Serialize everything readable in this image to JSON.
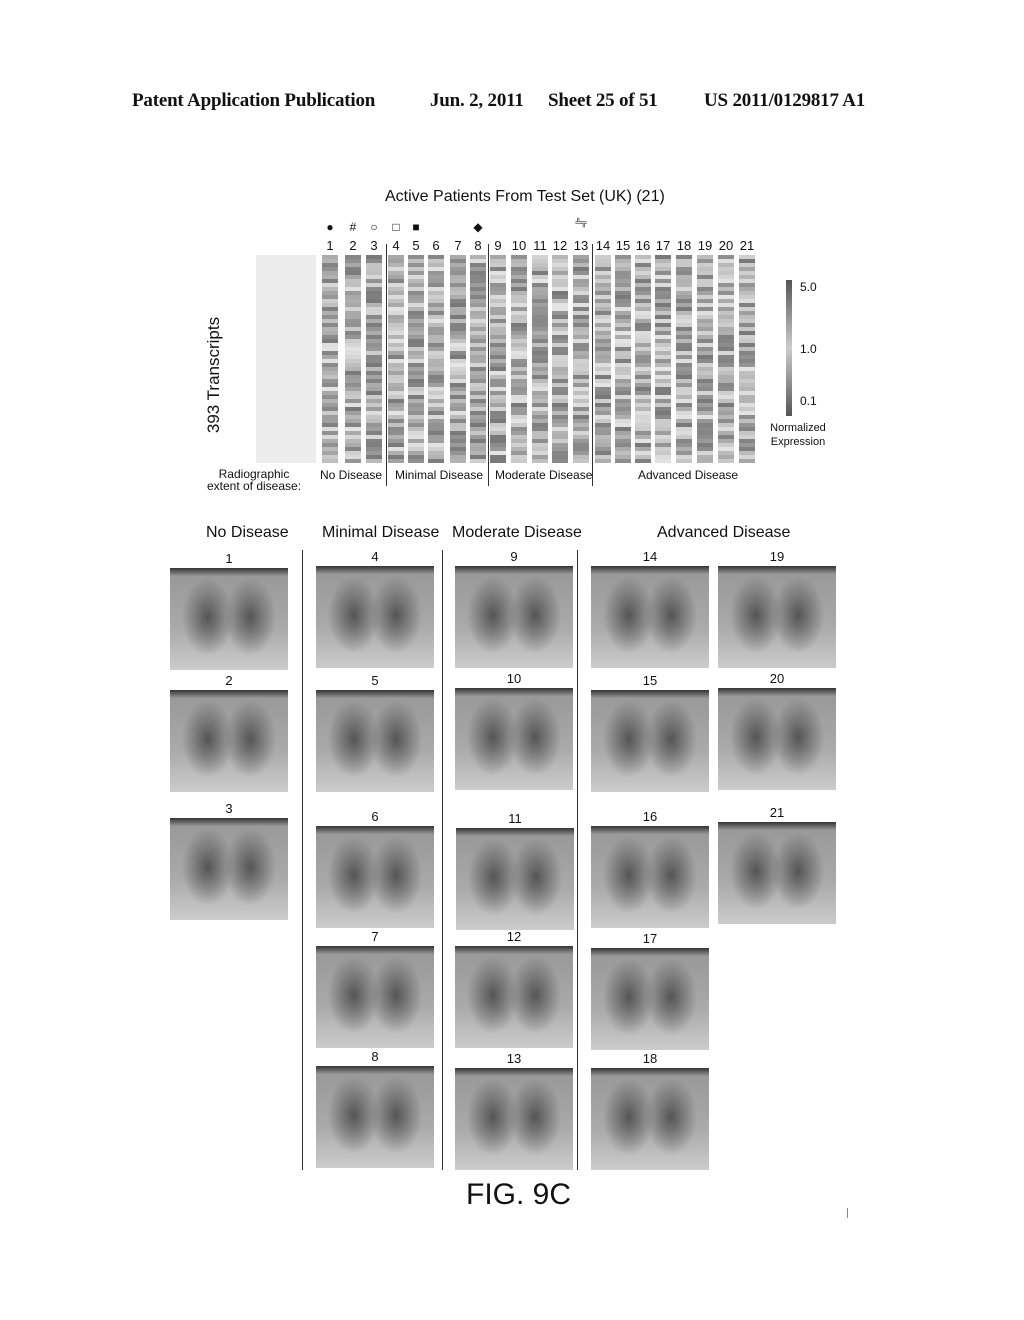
{
  "header": {
    "publication": "Patent Application Publication",
    "date": "Jun. 2, 2011",
    "sheet": "Sheet 25 of 51",
    "number": "US 2011/0129817 A1"
  },
  "heatmap": {
    "title": "Active Patients From Test Set (UK) (21)",
    "ylabel": "393 Transcripts",
    "columns": [
      "1",
      "2",
      "3",
      "4",
      "5",
      "6",
      "7",
      "8",
      "9",
      "10",
      "11",
      "12",
      "13",
      "14",
      "15",
      "16",
      "17",
      "18",
      "19",
      "20",
      "21"
    ],
    "markers": [
      {
        "col": "1",
        "symbol": "●"
      },
      {
        "col": "2",
        "symbol": "#"
      },
      {
        "col": "3",
        "symbol": "○"
      },
      {
        "col": "4",
        "symbol": "□"
      },
      {
        "col": "5",
        "symbol": "■"
      },
      {
        "col": "8",
        "symbol": "◆"
      },
      {
        "col": "13",
        "symbol": "╩╦"
      }
    ],
    "row_label": "Radiographic extent of disease:",
    "groups": [
      "No Disease",
      "Minimal Disease",
      "Moderate Disease",
      "Advanced Disease"
    ],
    "colorbar": {
      "ticks": [
        "5.0",
        "1.0",
        "0.1"
      ],
      "label": "Normalized Expression"
    }
  },
  "xray_panel": {
    "sections": [
      {
        "title": "No Disease",
        "patients": [
          "1",
          "2",
          "3"
        ]
      },
      {
        "title": "Minimal Disease",
        "patients": [
          "4",
          "5",
          "6",
          "7",
          "8"
        ]
      },
      {
        "title": "Moderate Disease",
        "patients": [
          "9",
          "10",
          "11",
          "12",
          "13"
        ]
      },
      {
        "title": "Advanced Disease",
        "patients": [
          "14",
          "15",
          "16",
          "17",
          "18",
          "19",
          "20",
          "21"
        ]
      }
    ]
  },
  "figure_label": "FIG. 9C"
}
